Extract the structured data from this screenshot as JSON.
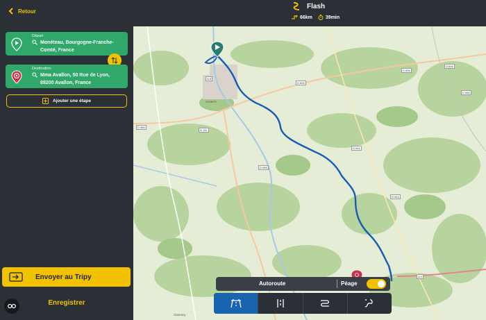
{
  "header": {
    "back_label": "Retour",
    "route_title": "Flash",
    "distance": "66km",
    "duration": "39min"
  },
  "route": {
    "departure_label": "Départ",
    "departure_address": "Monéteau, Bourgogne-Franche-Comté, France",
    "destination_label": "Destination",
    "destination_address": "Mma Avallon, 50 Rue de Lyon, 89200 Avallon, France",
    "add_step_label": "Ajouter une étape"
  },
  "actions": {
    "send_label": "Envoyer au Tripy",
    "save_label": "Enregistrer"
  },
  "controls": {
    "autoroute_label": "Autoroute",
    "peage_label": "Péage",
    "peage_enabled": true,
    "modes": [
      "highway-mode-icon",
      "road-mode-icon",
      "curvy-mode-icon",
      "winding-mode-icon"
    ],
    "active_mode": 0
  },
  "map": {
    "place_labels": [
      "Auxerre",
      "Clamecy",
      "D 965",
      "N 151",
      "D 606",
      "D 944",
      "D 965",
      "D 606",
      "A 6",
      "D 606",
      "D 944",
      "N 6",
      "D 965"
    ]
  },
  "colors": {
    "accent": "#f2c200",
    "card_green": "#2fa86a",
    "route_blue": "#1a5fb4",
    "panel": "#2b2f36",
    "destination_red": "#c8324b"
  }
}
